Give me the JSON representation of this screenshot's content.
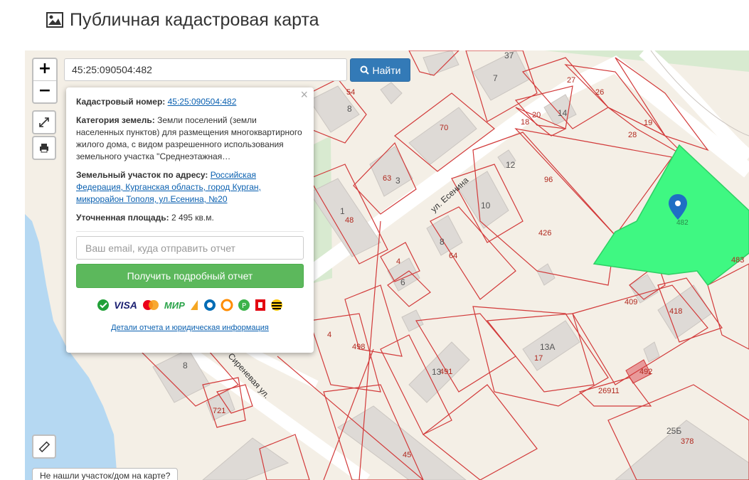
{
  "header": {
    "title": "Публичная кадастровая карта",
    "icon": "picture-icon"
  },
  "search": {
    "value": "45:25:090504:482",
    "button_label": "Найти"
  },
  "zoom": {
    "plus": "+",
    "minus": "−"
  },
  "popup": {
    "close": "×",
    "cadastral_label": "Кадастровый номер:",
    "cadastral_value": "45:25:090504:482",
    "category_label": "Категория земель:",
    "category_value": "Земли поселений (земли населенных пунктов) для размещения многоквартирного жилого дома, с видом разрешенного использования земельного участка \"Среднеэтажная…",
    "address_label": "Земельный участок по адресу:",
    "address_value": "Российская Федерация, Курганская область, город Курган, микрорайон Тополя, ул.Есенина, №20",
    "area_label": "Уточненная площадь:",
    "area_value": "2 495 кв.м.",
    "email_placeholder": "Ваш email, куда отправить отчет",
    "report_button": "Получить подробный отчет",
    "payment_icons": [
      "sberbank-icon",
      "visa-icon",
      "mastercard-icon",
      "mir-icon",
      "yandex-money-icon",
      "webmoney-icon",
      "qiwi-icon",
      "kiwi-icon",
      "mts-icon",
      "beeline-icon"
    ],
    "payment_visa": "VISA",
    "payment_mir": "МИР",
    "details_link": "Детали отчета и юридическая информация"
  },
  "map": {
    "streets": [
      "ул. Есенина",
      "Сиреневая ул."
    ],
    "parcel_labels": [
      "37",
      "54",
      "8",
      "27",
      "26",
      "19",
      "20",
      "14",
      "18",
      "28",
      "70",
      "7",
      "63",
      "3",
      "12",
      "96",
      "1",
      "48",
      "10",
      "426",
      "8",
      "64",
      "4",
      "6",
      "483",
      "409",
      "418",
      "4",
      "498",
      "13А",
      "17",
      "491",
      "13",
      "492",
      "26911",
      "8",
      "721",
      "45",
      "25Б",
      "378",
      "482"
    ],
    "selected_parcel": "482",
    "colors": {
      "selected": "#3ff882",
      "parcel_border": "#d23a3a",
      "water": "#b5d8f2",
      "building": "#dedad6",
      "background": "#f4efe6"
    }
  },
  "footer": {
    "not_found": "Не нашли участок/дом на карте?"
  }
}
